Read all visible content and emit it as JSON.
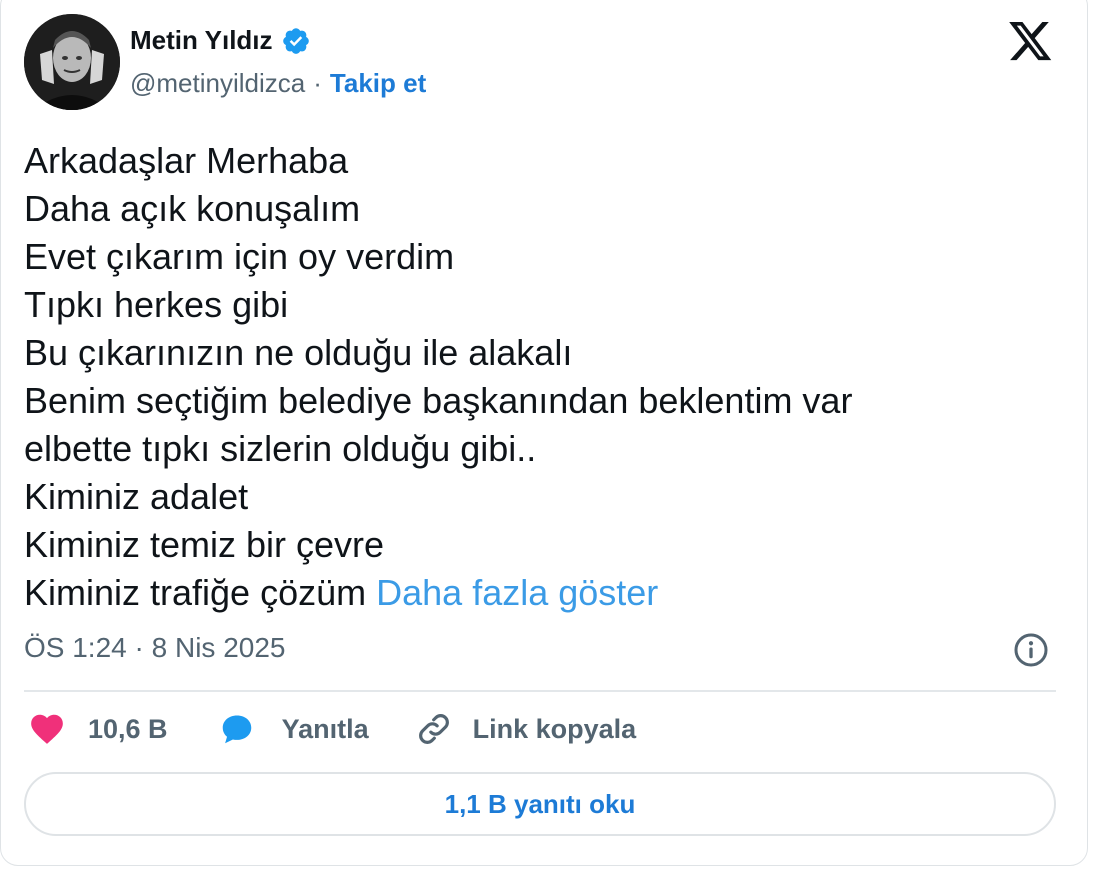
{
  "author": {
    "name": "Metin Yıldız",
    "handle": "@metinyildizca",
    "separator": "·",
    "follow_label": "Takip et"
  },
  "icons": {
    "verified": "verified-badge-icon",
    "logo": "x-logo-icon",
    "info": "info-icon",
    "like": "heart-icon",
    "reply": "speech-bubble-icon",
    "copy": "link-icon"
  },
  "colors": {
    "accent": "#1d7bd6",
    "link": "#3b9be6",
    "like": "#f0307a",
    "reply": "#1d9bf0",
    "muted": "#536471"
  },
  "tweet": {
    "lines": [
      "Arkadaşlar Merhaba",
      "Daha açık konuşalım",
      "Evet çıkarım için oy verdim",
      "Tıpkı herkes gibi",
      "Bu çıkarınızın ne olduğu ile alakalı",
      "Benim seçtiğim belediye başkanından beklentim var",
      "elbette tıpkı sizlerin olduğu gibi..",
      "Kiminiz adalet",
      "Kiminiz temiz bir çevre",
      "Kiminiz trafiğe çözüm"
    ],
    "show_more": "Daha fazla göster",
    "time": "ÖS 1:24",
    "dot": "·",
    "date": "8 Nis 2025"
  },
  "actions": {
    "like_count": "10,6 B",
    "reply_label": "Yanıtla",
    "copy_label": "Link kopyala"
  },
  "read_replies_label": "1,1 B yanıtı oku"
}
